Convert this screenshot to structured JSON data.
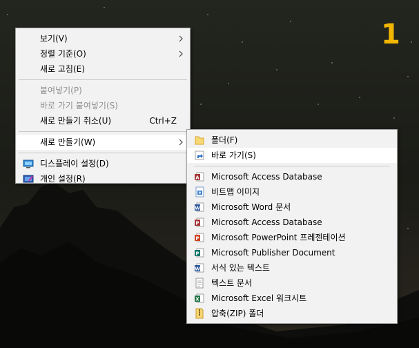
{
  "step_number": "1",
  "main_menu": {
    "items": [
      {
        "label": "보기(V)"
      },
      {
        "label": "정렬 기준(O)"
      },
      {
        "label": "새로 고침(E)"
      },
      {
        "label": "붙여넣기(P)"
      },
      {
        "label": "바로 가기 붙여넣기(S)"
      },
      {
        "label": "새로 만들기 취소(U)",
        "shortcut": "Ctrl+Z"
      },
      {
        "label": "새로 만들기(W)"
      },
      {
        "label": "디스플레이 설정(D)"
      },
      {
        "label": "개인 설정(R)"
      }
    ]
  },
  "sub_menu": {
    "items": [
      {
        "label": "폴더(F)",
        "icon": "folder-icon"
      },
      {
        "label": "바로 가기(S)",
        "icon": "shortcut-icon"
      },
      {
        "label": "Microsoft Access Database",
        "icon": "access-icon"
      },
      {
        "label": "비트맵 이미지",
        "icon": "bitmap-icon"
      },
      {
        "label": "Microsoft Word 문서",
        "icon": "word-icon"
      },
      {
        "label": "Microsoft Access Database",
        "icon": "access-icon"
      },
      {
        "label": "Microsoft PowerPoint 프레젠테이션",
        "icon": "powerpoint-icon"
      },
      {
        "label": "Microsoft Publisher Document",
        "icon": "publisher-icon"
      },
      {
        "label": "서식 있는 텍스트",
        "icon": "rtf-icon"
      },
      {
        "label": "텍스트 문서",
        "icon": "text-icon"
      },
      {
        "label": "Microsoft Excel 워크시트",
        "icon": "excel-icon"
      },
      {
        "label": "압축(ZIP) 폴더",
        "icon": "zip-folder-icon"
      }
    ]
  },
  "colors": {
    "step_number": "#f2b600",
    "menu_bg": "#f2f2f2",
    "highlight": "#ffffff",
    "disabled_text": "#8f8f8f"
  }
}
